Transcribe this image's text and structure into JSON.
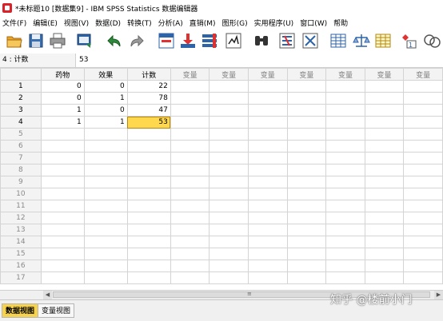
{
  "window": {
    "title": "*未标题10 [数据集9] - IBM SPSS Statistics 数据编辑器"
  },
  "menu": [
    "文件(F)",
    "编辑(E)",
    "视图(V)",
    "数据(D)",
    "转换(T)",
    "分析(A)",
    "直销(M)",
    "图形(G)",
    "实用程序(U)",
    "窗口(W)",
    "帮助"
  ],
  "toolbar": {
    "icons": [
      "open-folder-icon",
      "save-icon",
      "print-icon",
      "dialog-recall-icon",
      "undo-icon",
      "redo-icon",
      "goto-case-icon",
      "goto-variable-icon",
      "variables-icon",
      "find-icon",
      "run-descriptive-icon",
      "insert-cases-icon",
      "insert-variable-icon",
      "split-file-icon",
      "weight-cases-icon",
      "select-cases-icon",
      "value-labels-icon",
      "use-sets-icon"
    ]
  },
  "cell_editor": {
    "ref": "4 : 计数",
    "value": "53"
  },
  "grid": {
    "columns": [
      "药物",
      "效果",
      "计数",
      "变量",
      "变量",
      "变量",
      "变量",
      "变量",
      "变量",
      "变量"
    ],
    "rows": [
      [
        "1",
        "0",
        "0",
        "22"
      ],
      [
        "2",
        "0",
        "1",
        "78"
      ],
      [
        "3",
        "1",
        "0",
        "47"
      ],
      [
        "4",
        "1",
        "1",
        "53"
      ]
    ],
    "empty_rows": [
      "5",
      "6",
      "7",
      "8",
      "9",
      "10",
      "11",
      "12",
      "13",
      "14",
      "15",
      "16",
      "17"
    ]
  },
  "tabs": {
    "data_view": "数据视图",
    "variable_view": "变量视图"
  },
  "watermark": "知乎 @楼前小门"
}
